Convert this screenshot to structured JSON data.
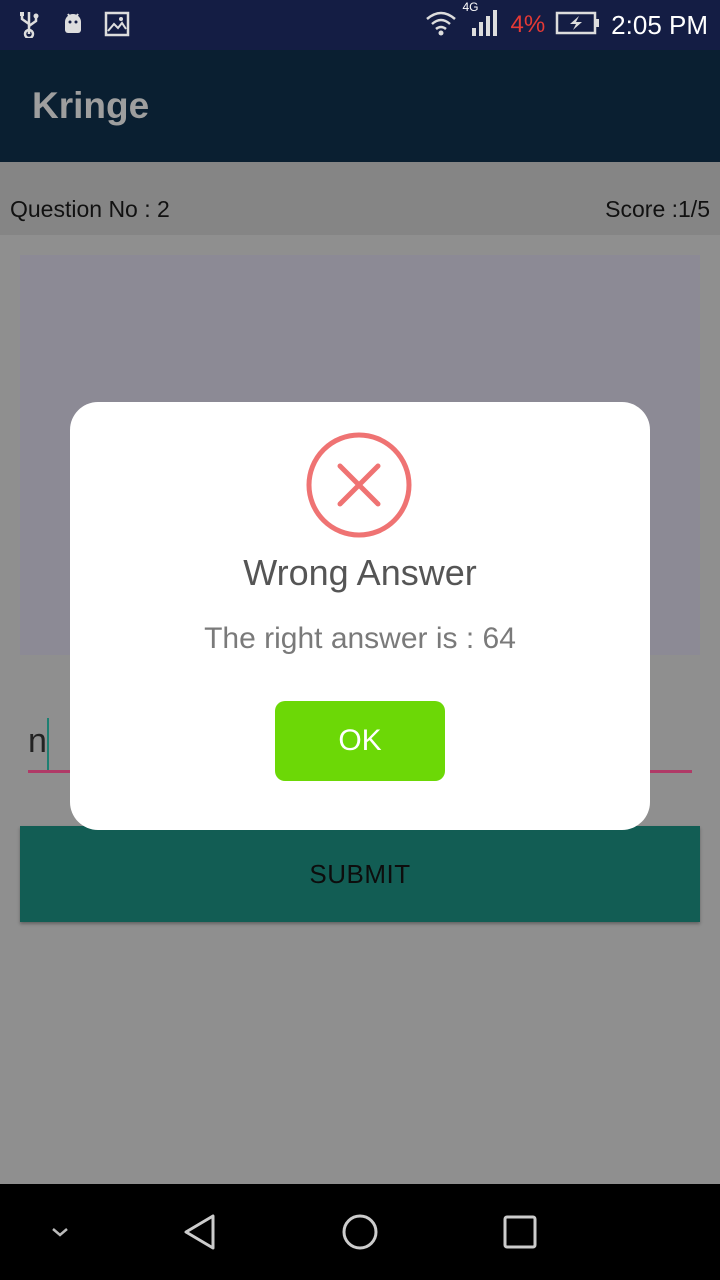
{
  "status_bar": {
    "time": "2:05 PM",
    "battery_percent": "4%",
    "network_type": "4G",
    "icons": [
      "usb-icon",
      "android-debug-icon",
      "image-icon",
      "wifi-icon",
      "signal-icon",
      "battery-charging-icon"
    ]
  },
  "app_bar": {
    "title": "Kringe"
  },
  "quiz": {
    "question_label": "Question No : 2",
    "score_label": "Score :1/5",
    "answer_value": "n",
    "submit_label": "SUBMIT"
  },
  "dialog": {
    "icon": "error-x-icon",
    "title": "Wrong Answer",
    "message": "The right answer is : 64",
    "ok_label": "OK"
  },
  "nav_bar": {
    "icons": [
      "collapse-chevron-icon",
      "back-icon",
      "home-icon",
      "recents-icon"
    ]
  },
  "colors": {
    "status_bar": "#141d44",
    "app_bar": "#0a1f31",
    "submit_button": "#125d54",
    "ok_button": "#6cd806",
    "error_red": "#ef7373",
    "input_underline": "#b03a67"
  }
}
